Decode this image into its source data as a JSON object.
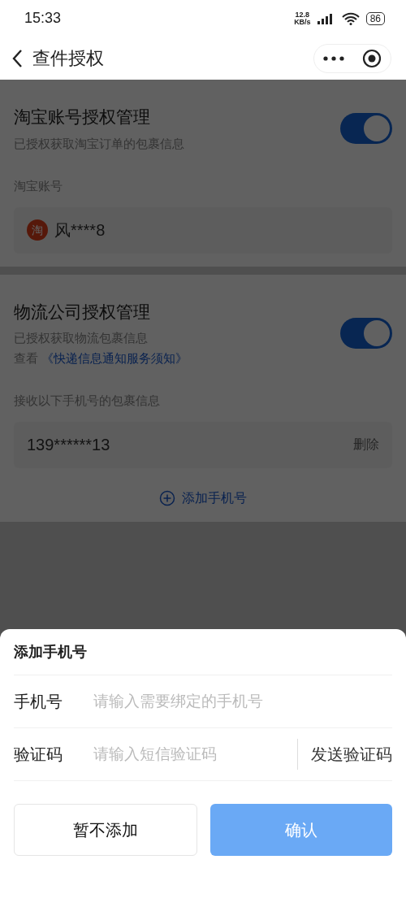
{
  "status_bar": {
    "time": "15:33",
    "net_speed_value": "12.8",
    "net_speed_unit": "KB/s",
    "battery": "86"
  },
  "header": {
    "title": "查件授权"
  },
  "sections": [
    {
      "title": "淘宝账号授权管理",
      "subtitle": "已授权获取淘宝订单的包裹信息",
      "enabled": true,
      "list_label": "淘宝账号",
      "items": [
        {
          "kind": "account",
          "logo_text": "淘",
          "text": "风****8"
        }
      ]
    },
    {
      "title": "物流公司授权管理",
      "subtitle": "已授权获取物流包裹信息",
      "link_prefix": "查看",
      "link": "《快递信息通知服务须知》",
      "enabled": true,
      "list_label": "接收以下手机号的包裹信息",
      "items": [
        {
          "kind": "phone",
          "text": "139******13",
          "action": "删除"
        }
      ],
      "add_button": "添加手机号"
    }
  ],
  "sheet": {
    "title": "添加手机号",
    "fields": [
      {
        "label": "手机号",
        "placeholder": "请输入需要绑定的手机号"
      },
      {
        "label": "验证码",
        "placeholder": "请输入短信验证码",
        "action": "发送验证码"
      }
    ],
    "buttons": [
      {
        "label": "暂不添加",
        "kind": "secondary"
      },
      {
        "label": "确认",
        "kind": "primary"
      }
    ]
  }
}
